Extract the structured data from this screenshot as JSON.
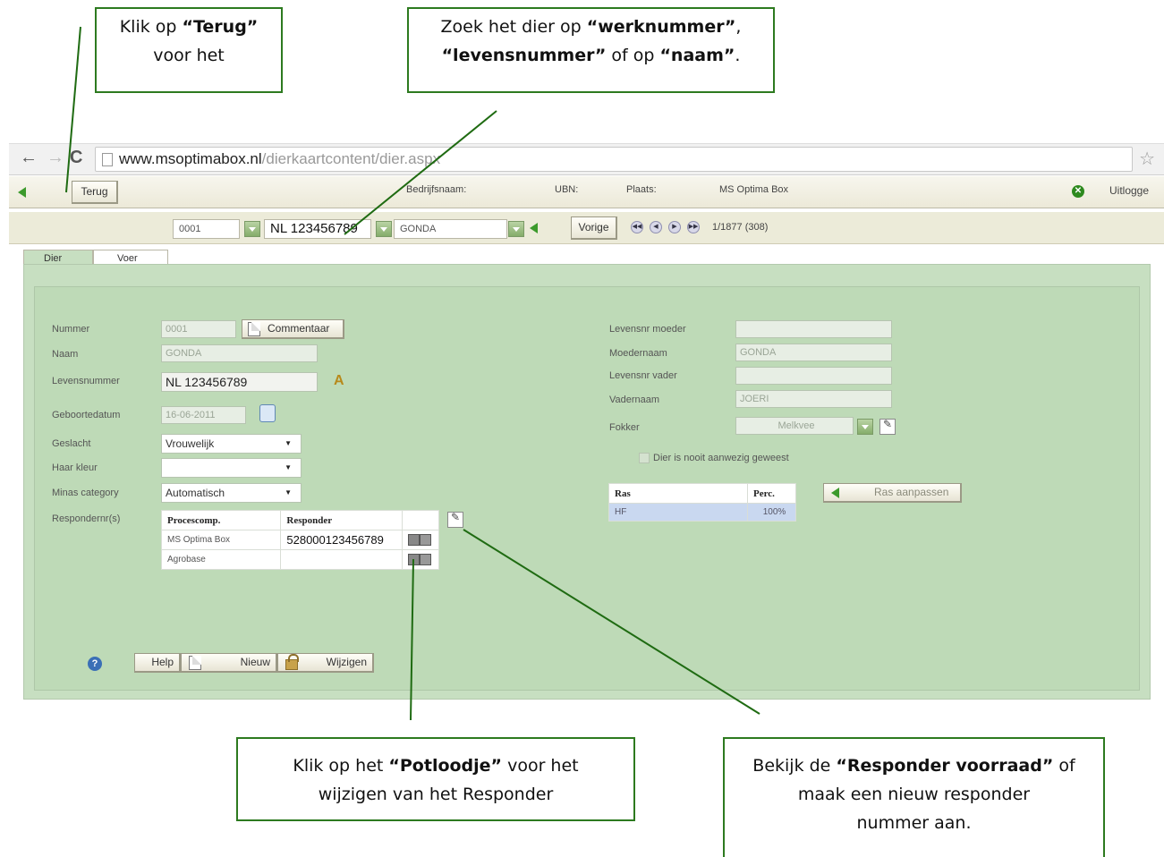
{
  "callouts": {
    "terug": {
      "line1_pre": "Klik op ",
      "line1_bold": "“Terug”",
      "line2": "voor het"
    },
    "zoek": {
      "pre": "Zoek het dier op ",
      "b1": "“werknummer”",
      "mid": ",",
      "b2": "“levensnummer”",
      "mid2": " of op ",
      "b3": "“naam”",
      "post": "."
    },
    "potlood": {
      "pre": "Klik op het ",
      "bold": "“Potloodje”",
      "post": " voor het",
      "line2": "wijzigen van het Responder"
    },
    "voorraad": {
      "pre": "Bekijk de ",
      "bold": "“Responder voorraad”",
      "post": " of",
      "line2": "maak een nieuw responder",
      "line3": "nummer aan."
    }
  },
  "browser": {
    "url_host": "www.msoptimabox.nl",
    "url_path": "/dierkaartcontent/dier.aspx"
  },
  "topbar": {
    "back_label": "Terug",
    "company_label": "Bedrijfsnaam:",
    "ubn_label": "UBN:",
    "place_label": "Plaats:",
    "company_value": "MS Optima Box",
    "logout_label": "Uitlogge"
  },
  "search": {
    "werknummer": "0001",
    "levensnummer": "NL 123456789",
    "naam": "GONDA",
    "prev_label": "Vorige",
    "position": "1/1877 (308)"
  },
  "tabs": [
    "Dier",
    "Voer"
  ],
  "form_left": {
    "nummer_label": "Nummer",
    "nummer_value": "0001",
    "comment_button": "Commentaar",
    "naam_label": "Naam",
    "naam_value": "GONDA",
    "levensnummer_label": "Levensnummer",
    "levensnummer_value": "NL 123456789",
    "geboortedatum_label": "Geboortedatum",
    "geboortedatum_value": "16-06-2011",
    "geslacht_label": "Geslacht",
    "geslacht_value": "Vrouwelijk",
    "haarkleur_label": "Haar kleur",
    "haarkleur_value": "",
    "minas_label": "Minas category",
    "minas_value": "Automatisch",
    "responders_label": "Respondernr(s)"
  },
  "responders": {
    "headers": [
      "Procescomp.",
      "Responder"
    ],
    "rows": [
      {
        "comp": "MS Optima Box",
        "resp": "528000123456789"
      },
      {
        "comp": "Agrobase",
        "resp": ""
      }
    ]
  },
  "form_right": {
    "levensnr_moeder_label": "Levensnr moeder",
    "levensnr_moeder_value": "",
    "moedernaam_label": "Moedernaam",
    "moedernaam_value": "GONDA",
    "levensnr_vader_label": "Levensnr vader",
    "levensnr_vader_value": "",
    "vadernaam_label": "Vadernaam",
    "vadernaam_value": "JOERI",
    "fokker_label": "Fokker",
    "fokker_value": "Melkvee",
    "nooit_aanwezig": "Dier is nooit aanwezig geweest"
  },
  "ras": {
    "headers": [
      "Ras",
      "Perc."
    ],
    "rows": [
      {
        "ras": "HF",
        "perc": "100%"
      }
    ],
    "button": "Ras aanpassen"
  },
  "bottom": {
    "help": "Help",
    "nieuw": "Nieuw",
    "wijzigen": "Wijzigen"
  }
}
